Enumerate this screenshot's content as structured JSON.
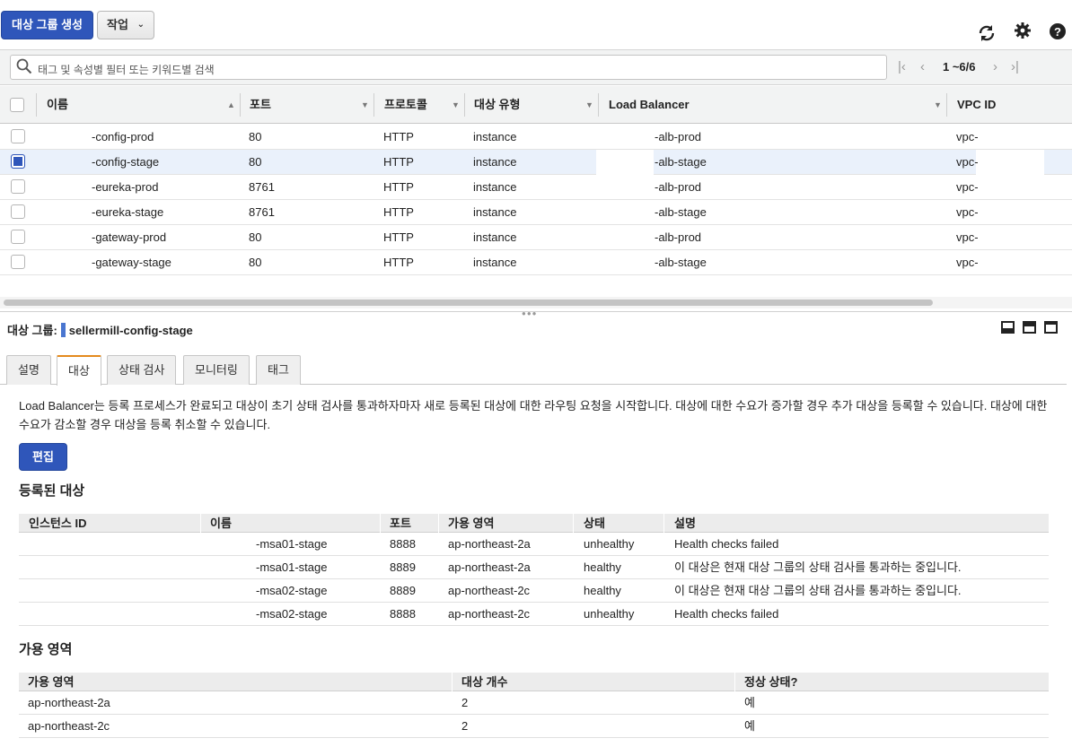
{
  "toolbar": {
    "create_label": "대상 그룹 생성",
    "actions_label": "작업",
    "refresh_icon": "refresh-icon",
    "settings_icon": "gear-icon",
    "help_icon": "help-icon"
  },
  "filter": {
    "placeholder": "태그 및 속성별 필터 또는 키워드별 검색",
    "page_text": "1 ~6/6"
  },
  "table": {
    "columns": [
      "이름",
      "포트",
      "프로토콜",
      "대상 유형",
      "Load Balancer",
      "VPC ID"
    ],
    "rows": [
      {
        "name": "-config-prod",
        "port": "80",
        "protocol": "HTTP",
        "type": "instance",
        "lb": "-alb-prod",
        "vpc": "vpc-",
        "selected": false
      },
      {
        "name": "-config-stage",
        "port": "80",
        "protocol": "HTTP",
        "type": "instance",
        "lb": "-alb-stage",
        "vpc": "vpc-",
        "selected": true
      },
      {
        "name": "-eureka-prod",
        "port": "8761",
        "protocol": "HTTP",
        "type": "instance",
        "lb": "-alb-prod",
        "vpc": "vpc-",
        "selected": false
      },
      {
        "name": "-eureka-stage",
        "port": "8761",
        "protocol": "HTTP",
        "type": "instance",
        "lb": "-alb-stage",
        "vpc": "vpc-",
        "selected": false
      },
      {
        "name": "-gateway-prod",
        "port": "80",
        "protocol": "HTTP",
        "type": "instance",
        "lb": "-alb-prod",
        "vpc": "vpc-",
        "selected": false
      },
      {
        "name": "-gateway-stage",
        "port": "80",
        "protocol": "HTTP",
        "type": "instance",
        "lb": "-alb-stage",
        "vpc": "vpc-",
        "selected": false
      }
    ]
  },
  "detail": {
    "label": "대상 그룹:",
    "name": "sellermill-config-stage",
    "tabs": [
      "설명",
      "대상",
      "상태 검사",
      "모니터링",
      "태그"
    ],
    "active_tab": "대상",
    "description": "Load Balancer는 등록 프로세스가 완료되고 대상이 초기 상태 검사를 통과하자마자 새로 등록된 대상에 대한 라우팅 요청을 시작합니다. 대상에 대한 수요가 증가할 경우 추가 대상을 등록할 수 있습니다. 대상에 대한 수요가 감소할 경우 대상을 등록 취소할 수 있습니다.",
    "edit_label": "편집",
    "registered_title": "등록된 대상",
    "registered_columns": [
      "인스턴스 ID",
      "이름",
      "포트",
      "가용 영역",
      "상태",
      "설명"
    ],
    "registered_rows": [
      {
        "id": "",
        "name": "-msa01-stage",
        "port": "8888",
        "zone": "ap-northeast-2a",
        "status": "unhealthy",
        "desc": "Health checks failed"
      },
      {
        "id": "",
        "name": "-msa01-stage",
        "port": "8889",
        "zone": "ap-northeast-2a",
        "status": "healthy",
        "desc": "이 대상은 현재 대상 그룹의 상태 검사를 통과하는 중입니다."
      },
      {
        "id": "",
        "name": "-msa02-stage",
        "port": "8889",
        "zone": "ap-northeast-2c",
        "status": "healthy",
        "desc": "이 대상은 현재 대상 그룹의 상태 검사를 통과하는 중입니다."
      },
      {
        "id": "",
        "name": "-msa02-stage",
        "port": "8888",
        "zone": "ap-northeast-2c",
        "status": "unhealthy",
        "desc": "Health checks failed"
      }
    ],
    "az_title": "가용 영역",
    "az_columns": [
      "가용 영역",
      "대상 개수",
      "정상 상태?"
    ],
    "az_rows": [
      {
        "zone": "ap-northeast-2a",
        "count": "2",
        "healthy": "예"
      },
      {
        "zone": "ap-northeast-2c",
        "count": "2",
        "healthy": "예"
      }
    ]
  },
  "colors": {
    "primary": "#2f56ba",
    "active_tab": "#e48a1d",
    "selected_row": "#eaf1fb"
  }
}
